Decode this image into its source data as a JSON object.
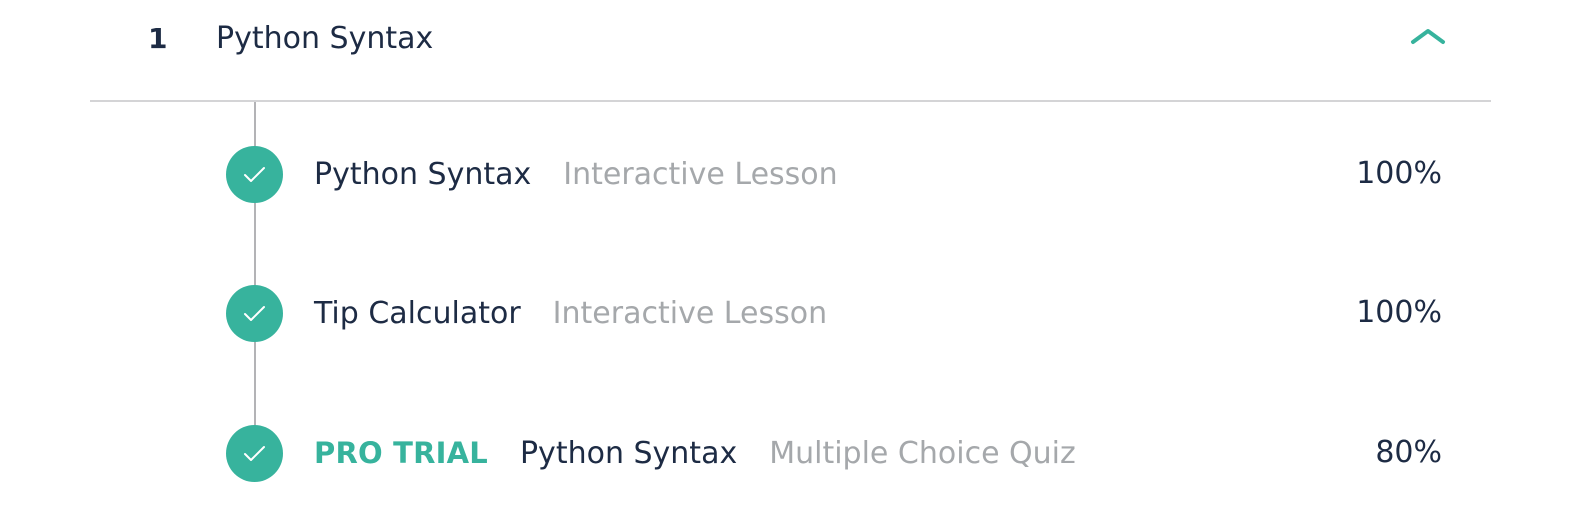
{
  "module": {
    "number": "1",
    "title": "Python Syntax",
    "toggle_icon": "chevron-up-icon",
    "accent_color": "#37b39d"
  },
  "lessons": [
    {
      "badge": "",
      "title": "Python Syntax",
      "type": "Interactive Lesson",
      "progress": "100%",
      "completed": true,
      "status_icon": "check-icon"
    },
    {
      "badge": "",
      "title": "Tip Calculator",
      "type": "Interactive Lesson",
      "progress": "100%",
      "completed": true,
      "status_icon": "check-icon"
    },
    {
      "badge": "PRO TRIAL",
      "title": "Python Syntax",
      "type": "Multiple Choice Quiz",
      "progress": "80%",
      "completed": true,
      "status_icon": "check-icon"
    }
  ]
}
